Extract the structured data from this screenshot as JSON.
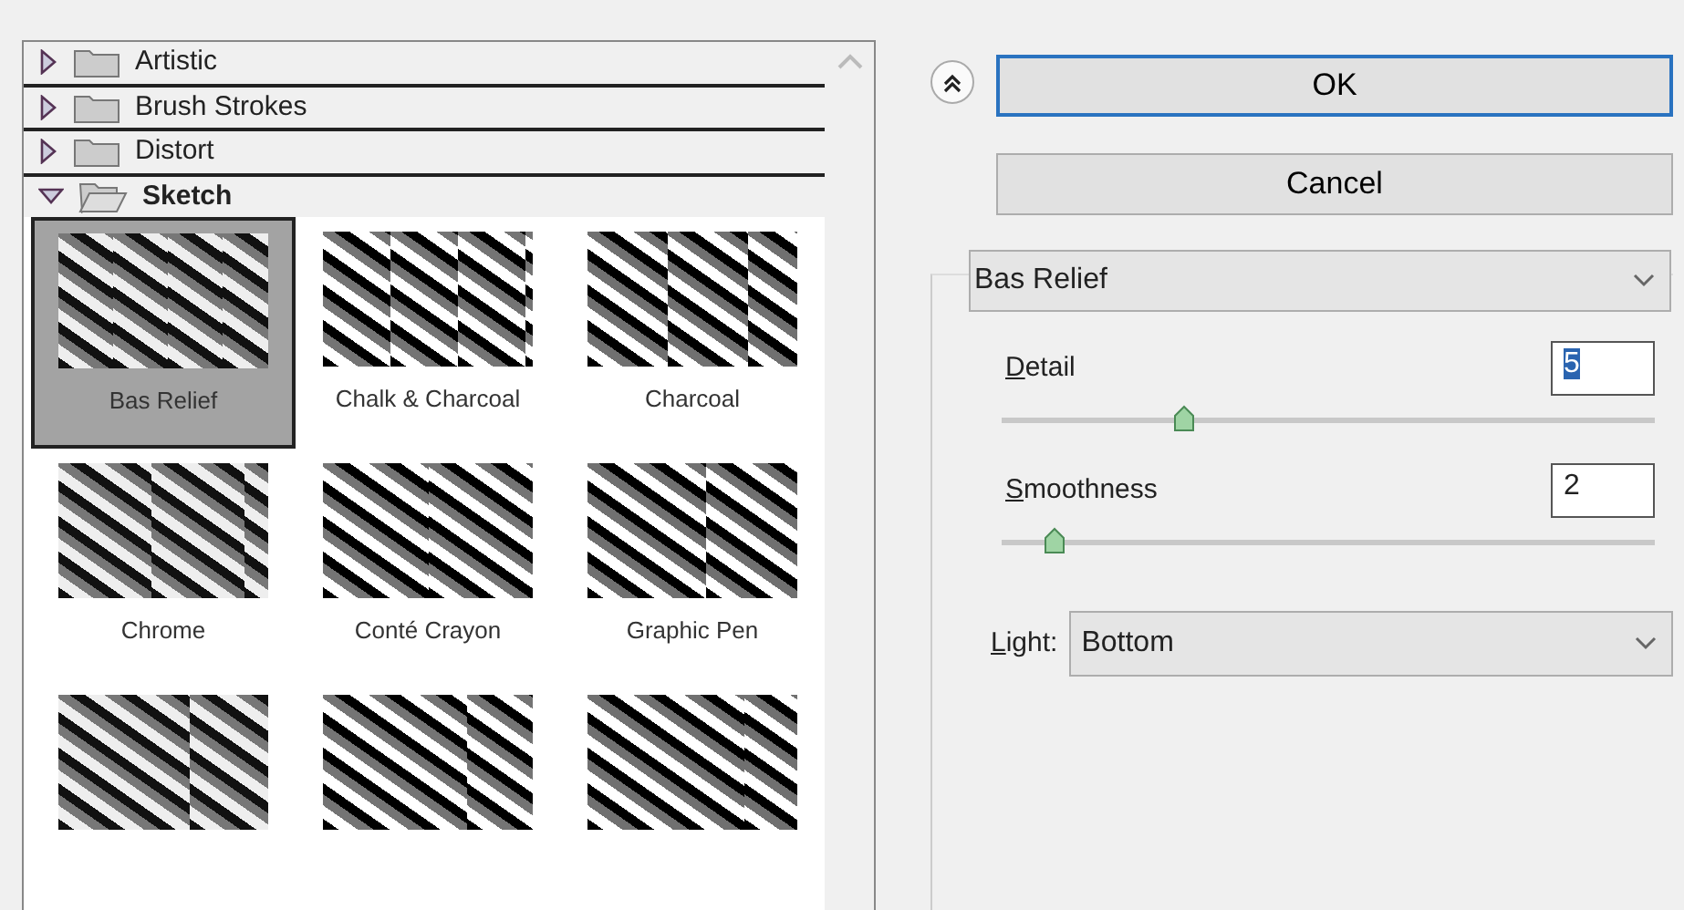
{
  "categories": [
    {
      "label": "Artistic",
      "expanded": false
    },
    {
      "label": "Brush Strokes",
      "expanded": false
    },
    {
      "label": "Distort",
      "expanded": false
    },
    {
      "label": "Sketch",
      "expanded": true,
      "filters": [
        {
          "label": "Bas Relief",
          "selected": true
        },
        {
          "label": "Chalk & Charcoal",
          "selected": false
        },
        {
          "label": "Charcoal",
          "selected": false
        },
        {
          "label": "Chrome",
          "selected": false
        },
        {
          "label": "Conté Crayon",
          "selected": false
        },
        {
          "label": "Graphic Pen",
          "selected": false
        },
        {
          "selected": false
        },
        {
          "selected": false
        },
        {
          "selected": false
        }
      ]
    }
  ],
  "buttons": [
    {
      "label": "OK",
      "default": true
    },
    {
      "label": "Cancel",
      "default": false
    }
  ],
  "filter_select": {
    "value": "Bas Relief"
  },
  "sliders": [
    {
      "label": "Detail",
      "value": "5",
      "highlighted": true,
      "level": 0.28
    },
    {
      "label": "Smoothness",
      "value": "2",
      "highlighted": false,
      "level": 0.08
    }
  ],
  "light": {
    "label": "Light:",
    "value": "Bottom"
  }
}
